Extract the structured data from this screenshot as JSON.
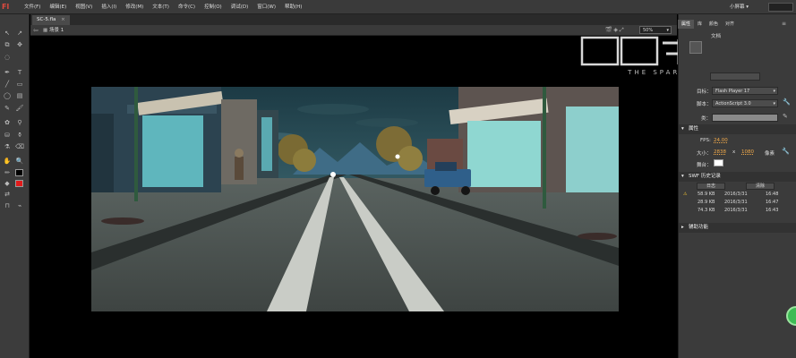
{
  "app": {
    "logo": "Fl"
  },
  "menu": [
    "文件(F)",
    "编辑(E)",
    "视图(V)",
    "插入(I)",
    "修改(M)",
    "文本(T)",
    "命令(C)",
    "控制(O)",
    "调试(D)",
    "窗口(W)",
    "帮助(H)"
  ],
  "workspace_label": "小屏幕 ▾",
  "document": {
    "tab": "SC-5.fla",
    "scene": "场景 1",
    "zoom": "50%"
  },
  "watermark_text": "THE SPARK",
  "panel": {
    "tabs": [
      "属性",
      "库",
      "颜色",
      "对齐"
    ],
    "doc_label": "文档",
    "target_label": "目标：",
    "target_value": "Flash Player 17",
    "script_label": "脚本：",
    "script_value": "ActionScript 3.0",
    "class_label": "类：",
    "properties_header": "属性",
    "fps_label": "FPS:",
    "fps_value": "24.00",
    "size_label": "大小：",
    "width_value": "2838",
    "x_sep": "x",
    "height_value": "1080",
    "unit_label": "像素",
    "stage_label": "舞台：",
    "swf_header": "SWF 历史记录",
    "history_button": "日志",
    "history_clear": "清除",
    "history": [
      {
        "size": "58.9 KB",
        "date": "2016/3/31",
        "time": "16:48",
        "warn": true
      },
      {
        "size": "28.9 KB",
        "date": "2016/3/31",
        "time": "16:47",
        "warn": false
      },
      {
        "size": "74.3 KB",
        "date": "2016/3/31",
        "time": "16:43",
        "warn": false
      }
    ],
    "accessibility_header": "辅助功能"
  },
  "colors": {
    "stroke": "#000000",
    "fill": "#e21a1a",
    "stage_bg": "#ffffff",
    "accent": "#f1a94a"
  }
}
